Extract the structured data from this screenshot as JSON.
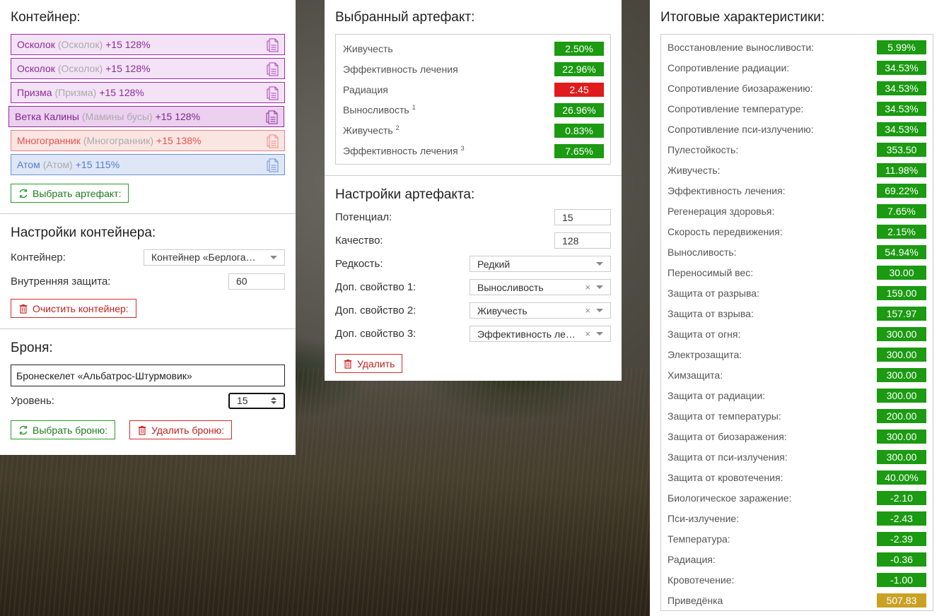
{
  "container_section": {
    "title": "Контейнер:",
    "slots": [
      {
        "name": "Осколок",
        "sub": "(Осколок)",
        "bonus": "+15 128%",
        "style": "purple"
      },
      {
        "name": "Осколок",
        "sub": "(Осколок)",
        "bonus": "+15 128%",
        "style": "purple"
      },
      {
        "name": "Призма",
        "sub": "(Призма)",
        "bonus": "+15 128%",
        "style": "purple"
      },
      {
        "name": "Ветка Калины",
        "sub": "(Мамины бусы)",
        "bonus": "+15 128%",
        "style": "purple-dark"
      },
      {
        "name": "Многогранник",
        "sub": "(Многогранник)",
        "bonus": "+15 138%",
        "style": "red"
      },
      {
        "name": "Атом",
        "sub": "(Атом)",
        "bonus": "+15 115%",
        "style": "blue"
      }
    ],
    "select_artifact_button": "Выбрать артефакт:"
  },
  "container_settings": {
    "title": "Настройки контейнера:",
    "container_label": "Контейнер:",
    "container_value": "Контейнер «Берлога…",
    "protection_label": "Внутренняя защита:",
    "protection_value": "60",
    "clear_button": "Очистить контейнер:"
  },
  "armor": {
    "title": "Броня:",
    "armor_name": "Бронескелет «Альбатрос-Штурмовик»",
    "level_label": "Уровень:",
    "level_value": "15",
    "select_button": "Выбрать броню:",
    "delete_button": "Удалить броню:"
  },
  "selected_artifact": {
    "title": "Выбранный артефакт:",
    "stats": [
      {
        "name": "Живучесть",
        "sup": "",
        "value": "2.50%",
        "color": "green"
      },
      {
        "name": "Эффективность лечения",
        "sup": "",
        "value": "22.96%",
        "color": "green"
      },
      {
        "name": "Радиация",
        "sup": "",
        "value": "2.45",
        "color": "red"
      },
      {
        "name": "Выносливость",
        "sup": "1",
        "value": "26.96%",
        "color": "green"
      },
      {
        "name": "Живучесть",
        "sup": "2",
        "value": "0.83%",
        "color": "green"
      },
      {
        "name": "Эффективность лечения",
        "sup": "3",
        "value": "7.65%",
        "color": "green"
      }
    ]
  },
  "artifact_settings": {
    "title": "Настройки артефакта:",
    "potential_label": "Потенциал:",
    "potential_value": "15",
    "quality_label": "Качество:",
    "quality_value": "128",
    "rarity_label": "Редкость:",
    "rarity_value": "Редкий",
    "extra1_label": "Доп. свойство 1:",
    "extra1_value": "Выносливость",
    "extra2_label": "Доп. свойство 2:",
    "extra2_value": "Живучесть",
    "extra3_label": "Доп. свойство 3:",
    "extra3_value": "Эффективность ле…",
    "clear_symbol": "×",
    "delete_button": "Удалить"
  },
  "totals": {
    "title": "Итоговые характеристики:",
    "stats": [
      {
        "name": "Восстановление выносливости:",
        "value": "5.99%",
        "color": "green"
      },
      {
        "name": "Сопротивление радиации:",
        "value": "34.53%",
        "color": "green"
      },
      {
        "name": "Сопротивление биозаражению:",
        "value": "34.53%",
        "color": "green"
      },
      {
        "name": "Сопротивление температуре:",
        "value": "34.53%",
        "color": "green"
      },
      {
        "name": "Сопротивление пси-излучению:",
        "value": "34.53%",
        "color": "green"
      },
      {
        "name": "Пулестойкость:",
        "value": "353.50",
        "color": "green"
      },
      {
        "name": "Живучесть:",
        "value": "11.98%",
        "color": "green"
      },
      {
        "name": "Эффективность лечения:",
        "value": "69.22%",
        "color": "green"
      },
      {
        "name": "Регенерация здоровья:",
        "value": "7.65%",
        "color": "green"
      },
      {
        "name": "Скорость передвижения:",
        "value": "2.15%",
        "color": "green"
      },
      {
        "name": "Выносливость:",
        "value": "54.94%",
        "color": "green"
      },
      {
        "name": "Переносимый вес:",
        "value": "30.00",
        "color": "green"
      },
      {
        "name": "Защита от разрыва:",
        "value": "159.00",
        "color": "green"
      },
      {
        "name": "Защита от взрыва:",
        "value": "157.97",
        "color": "green"
      },
      {
        "name": "Защита от огня:",
        "value": "300.00",
        "color": "green"
      },
      {
        "name": "Электрозащита:",
        "value": "300.00",
        "color": "green"
      },
      {
        "name": "Химзащита:",
        "value": "300.00",
        "color": "green"
      },
      {
        "name": "Защита от радиации:",
        "value": "300.00",
        "color": "green"
      },
      {
        "name": "Защита от температуры:",
        "value": "200.00",
        "color": "green"
      },
      {
        "name": "Защита от биозаражения:",
        "value": "300.00",
        "color": "green"
      },
      {
        "name": "Защита от пси-излучения:",
        "value": "300.00",
        "color": "green"
      },
      {
        "name": "Защита от кровотечения:",
        "value": "40.00%",
        "color": "green"
      },
      {
        "name": "Биологическое заражение:",
        "value": "-2.10",
        "color": "green"
      },
      {
        "name": "Пси-излучение:",
        "value": "-2.43",
        "color": "green"
      },
      {
        "name": "Температура:",
        "value": "-2.39",
        "color": "green"
      },
      {
        "name": "Радиация:",
        "value": "-0.36",
        "color": "green"
      },
      {
        "name": "Кровотечение:",
        "value": "-1.00",
        "color": "green"
      },
      {
        "name": "Приведёнка",
        "value": "507.83",
        "color": "gold"
      }
    ]
  },
  "colors": {
    "green": "#1b9a12",
    "red": "#e01b1b",
    "gold": "#c9a224",
    "purple": "#8d2b9a",
    "slot_red": "#e2534a",
    "slot_blue": "#4f7dd0"
  },
  "icons": {
    "slot_icon": "document-icon",
    "select_icon": "refresh-icon",
    "delete_icon": "trash-icon"
  }
}
